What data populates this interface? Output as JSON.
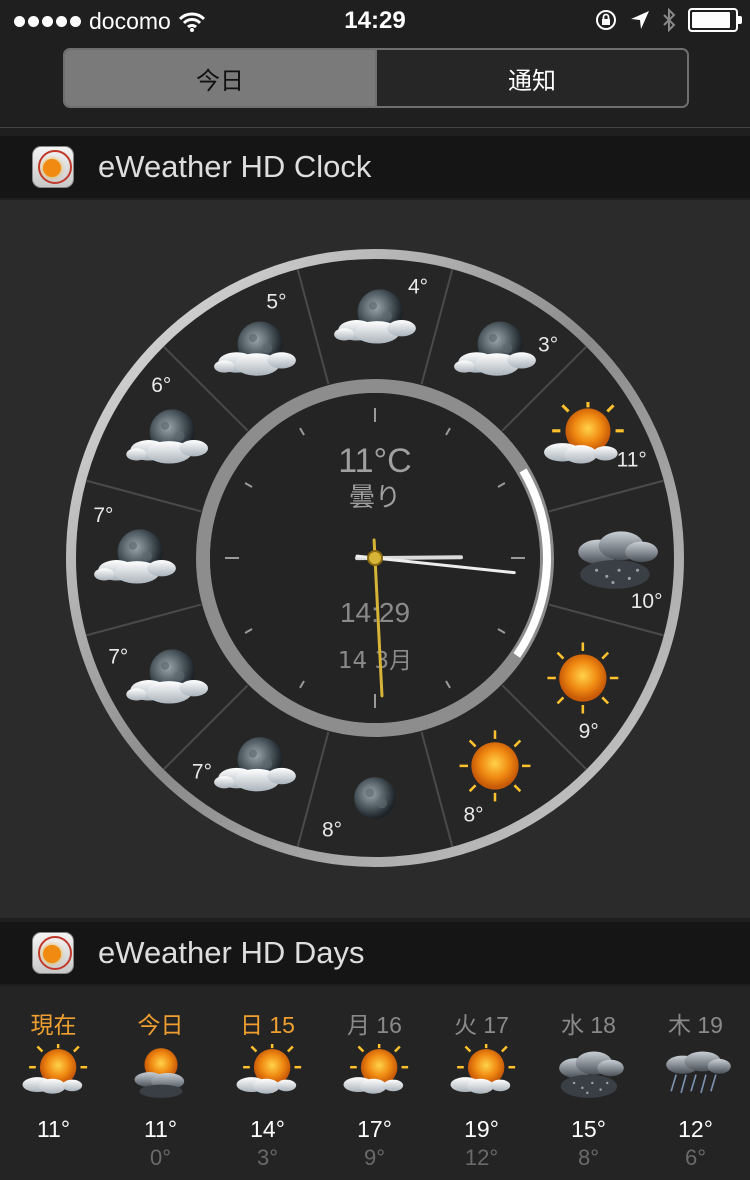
{
  "status_bar": {
    "carrier": "docomo",
    "time": "14:29",
    "icons": [
      "signal-dots",
      "wifi-icon",
      "rotation-lock-icon",
      "location-arrow-icon",
      "bluetooth-icon",
      "battery-icon"
    ]
  },
  "segmented": {
    "today_label": "今日",
    "notifications_label": "通知",
    "selected": "今日"
  },
  "clock_widget": {
    "title": "eWeather HD Clock",
    "temperature": "11°C",
    "condition": "曇り",
    "digital_time": "14:29",
    "date": "14 3月",
    "analog": {
      "hour": 14,
      "minute": 29,
      "seconds": 31
    },
    "hours": [
      {
        "temp": "4°",
        "icon": "cloudy-night-icon"
      },
      {
        "temp": "3°",
        "icon": "cloudy-night-icon"
      },
      {
        "temp": "11°",
        "icon": "partly-sunny-icon"
      },
      {
        "temp": "10°",
        "icon": "rain-icon"
      },
      {
        "temp": "9°",
        "icon": "sun-icon"
      },
      {
        "temp": "8°",
        "icon": "sun-icon"
      },
      {
        "temp": "8°",
        "icon": "moon-icon"
      },
      {
        "temp": "7°",
        "icon": "cloudy-night-icon"
      },
      {
        "temp": "7°",
        "icon": "cloudy-night-icon"
      },
      {
        "temp": "7°",
        "icon": "cloudy-night-icon"
      },
      {
        "temp": "6°",
        "icon": "cloudy-night-icon"
      },
      {
        "temp": "5°",
        "icon": "cloudy-night-icon"
      }
    ],
    "colors": {
      "hour_hand": "#d6b437",
      "ring": "#bdbdbd"
    }
  },
  "days_widget": {
    "title": "eWeather HD Days",
    "days": [
      {
        "label": "現在",
        "hi": "11°",
        "lo": "",
        "icon": "partly-sunny-icon",
        "color": "#f0a030"
      },
      {
        "label": "今日",
        "hi": "11°",
        "lo": "0°",
        "icon": "sun-rain-icon",
        "color": "#f0a030"
      },
      {
        "label": "日 15",
        "hi": "14°",
        "lo": "3°",
        "icon": "partly-sunny-icon",
        "color": "#f0a030"
      },
      {
        "label": "月 16",
        "hi": "17°",
        "lo": "9°",
        "icon": "partly-sunny-icon",
        "color": "#8a8a8a"
      },
      {
        "label": "火 17",
        "hi": "19°",
        "lo": "12°",
        "icon": "partly-sunny-icon",
        "color": "#8a8a8a"
      },
      {
        "label": "水 18",
        "hi": "15°",
        "lo": "8°",
        "icon": "rain-icon",
        "color": "#8a8a8a"
      },
      {
        "label": "木 19",
        "hi": "12°",
        "lo": "6°",
        "icon": "heavy-rain-icon",
        "color": "#8a8a8a"
      }
    ]
  }
}
